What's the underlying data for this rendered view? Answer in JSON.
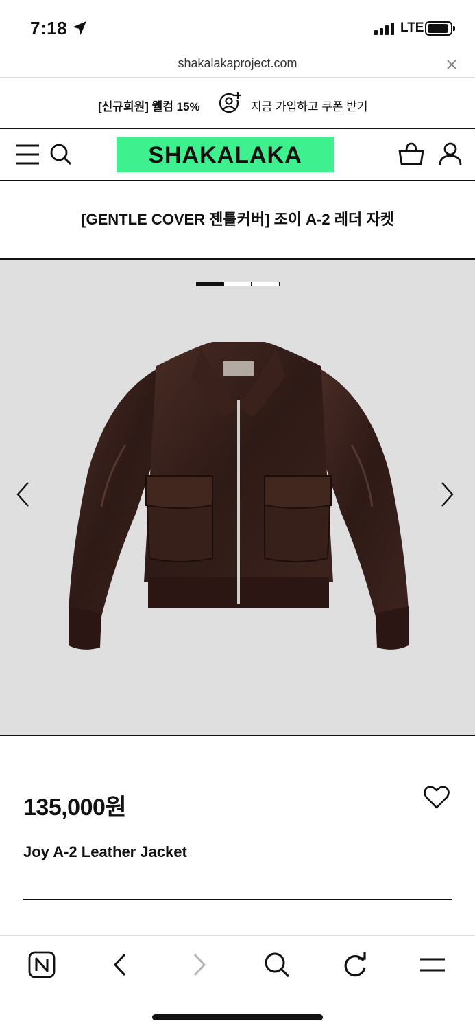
{
  "status_bar": {
    "time": "7:18",
    "network": "LTE"
  },
  "browser": {
    "url": "shakalakaproject.com"
  },
  "promo": {
    "left_text": "[신규회원] 웰컴 15%",
    "right_text": "지금 가입하고 쿠폰 받기"
  },
  "header": {
    "logo_text": "SHAKALAKA",
    "logo_bg": "#3ef18e"
  },
  "product": {
    "title": "[GENTLE COVER 젠틀커버] 조이 A-2 레더 자켓",
    "price": "135,000원",
    "name_en": "Joy A-2 Leather Jacket",
    "image_count": 3,
    "current_image": 1
  },
  "toolbar": {
    "icons": [
      "naver-n-icon",
      "back-icon",
      "forward-icon",
      "search-icon",
      "refresh-icon",
      "menu-icon"
    ]
  }
}
